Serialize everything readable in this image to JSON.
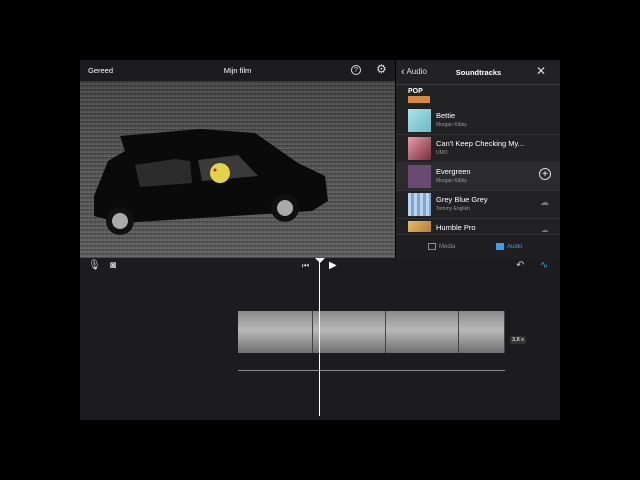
{
  "toolbar": {
    "done_label": "Gereed",
    "title": "Mijn film",
    "help_icon": "?"
  },
  "panel": {
    "back_label": "Audio",
    "title": "Soundtracks",
    "section": "POP",
    "tracks": [
      {
        "name": "Bettie",
        "artist": "Morgan Kibby",
        "action": "none",
        "thumb": "#9fd8dc"
      },
      {
        "name": "Can't Keep Checking My...",
        "artist": "UMO",
        "action": "none",
        "thumb": "#c9657a"
      },
      {
        "name": "Evergreen",
        "artist": "Morgan Kibby",
        "action": "add",
        "thumb": "#6a4a72"
      },
      {
        "name": "Grey Blue Grey",
        "artist": "Tommy English",
        "action": "download",
        "thumb": "#9bbfe0"
      },
      {
        "name": "Humble Pro",
        "artist": "",
        "action": "download",
        "thumb": "#d2a040"
      }
    ],
    "tabs": [
      {
        "label": "Media",
        "active": false
      },
      {
        "label": "Audio",
        "active": true
      }
    ]
  },
  "timeline": {
    "duration": "3,8 s"
  },
  "colors": {
    "accent": "#3b9cf0",
    "background": "#1c1c1e"
  }
}
